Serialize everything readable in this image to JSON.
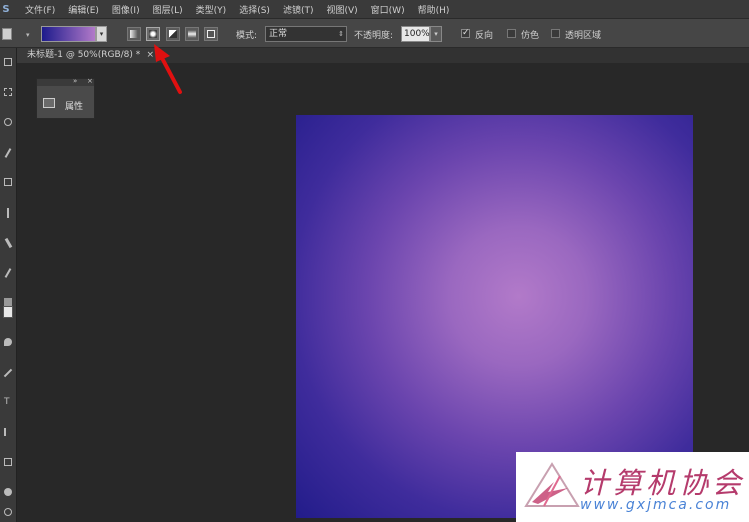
{
  "menubar": {
    "logo": "S",
    "items": [
      "文件(F)",
      "编辑(E)",
      "图像(I)",
      "图层(L)",
      "类型(Y)",
      "选择(S)",
      "滤镜(T)",
      "视图(V)",
      "窗口(W)",
      "帮助(H)"
    ]
  },
  "options": {
    "mode_label": "模式:",
    "mode_value": "正常",
    "opacity_label": "不透明度:",
    "opacity_value": "100%",
    "reverse_label": "反向",
    "dither_label": "仿色",
    "transparency_label": "透明区域",
    "gradient_colors": [
      "#1d1b8c",
      "#b27ac9"
    ]
  },
  "document_tab": {
    "title": "未标题-1 @ 50%(RGB/8) *",
    "close": "×"
  },
  "properties_panel": {
    "label": "属性",
    "collapse": "»",
    "close": "×"
  },
  "canvas": {
    "inner_color": "#b27ac9",
    "outer_color": "#221c8a"
  },
  "watermark": {
    "title": "计算机协会",
    "url": "www.gxjmca.com"
  }
}
